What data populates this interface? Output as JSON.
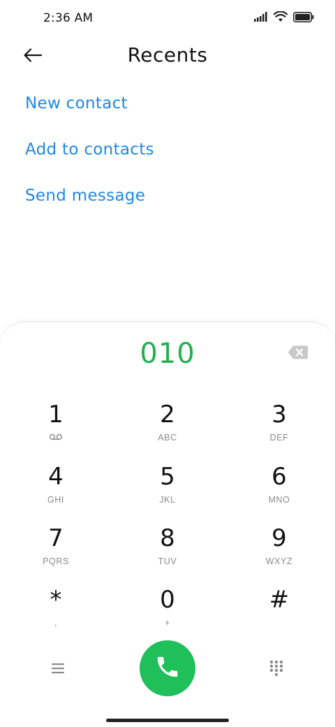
{
  "status_bar": {
    "time": "2:36 AM",
    "icons": [
      "signal-icon",
      "wifi-icon",
      "battery-icon"
    ]
  },
  "header": {
    "title": "Recents",
    "back_icon": "arrow-left-icon"
  },
  "actions": {
    "new_contact": "New contact",
    "add_to_contacts": "Add to contacts",
    "send_message": "Send message"
  },
  "dialer": {
    "number": "010",
    "backspace_icon": "backspace-icon",
    "keys": [
      {
        "digit": "1",
        "letters": ""
      },
      {
        "digit": "2",
        "letters": "ABC"
      },
      {
        "digit": "3",
        "letters": "DEF"
      },
      {
        "digit": "4",
        "letters": "GHI"
      },
      {
        "digit": "5",
        "letters": "JKL"
      },
      {
        "digit": "6",
        "letters": "MNO"
      },
      {
        "digit": "7",
        "letters": "PQRS"
      },
      {
        "digit": "8",
        "letters": "TUV"
      },
      {
        "digit": "9",
        "letters": "WXYZ"
      },
      {
        "digit": "*",
        "letters": ","
      },
      {
        "digit": "0",
        "letters": "+"
      },
      {
        "digit": "#",
        "letters": ""
      }
    ],
    "menu_icon": "menu-icon",
    "call_icon": "phone-icon",
    "dialpad_icon": "dialpad-icon"
  },
  "colors": {
    "accent_link": "#1e88e5",
    "number_green": "#22b04f",
    "call_green": "#1fbf5a"
  }
}
